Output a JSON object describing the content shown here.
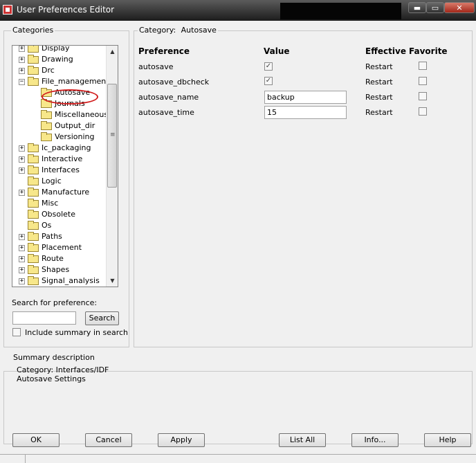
{
  "window": {
    "title": "User Preferences Editor",
    "minimize": "▬",
    "maximize": "▭",
    "close": "✕"
  },
  "categories": {
    "label": "Categories",
    "items": [
      {
        "label": "Display",
        "expander": "+"
      },
      {
        "label": "Drawing",
        "expander": "+"
      },
      {
        "label": "Drc",
        "expander": "+"
      },
      {
        "label": "File_management",
        "expander": "−"
      },
      {
        "label": "Autosave",
        "expander": ""
      },
      {
        "label": "Journals",
        "expander": ""
      },
      {
        "label": "Miscellaneous",
        "expander": ""
      },
      {
        "label": "Output_dir",
        "expander": ""
      },
      {
        "label": "Versioning",
        "expander": ""
      },
      {
        "label": "Ic_packaging",
        "expander": "+"
      },
      {
        "label": "Interactive",
        "expander": "+"
      },
      {
        "label": "Interfaces",
        "expander": "+"
      },
      {
        "label": "Logic",
        "expander": ""
      },
      {
        "label": "Manufacture",
        "expander": "+"
      },
      {
        "label": "Misc",
        "expander": ""
      },
      {
        "label": "Obsolete",
        "expander": ""
      },
      {
        "label": "Os",
        "expander": ""
      },
      {
        "label": "Paths",
        "expander": "+"
      },
      {
        "label": "Placement",
        "expander": "+"
      },
      {
        "label": "Route",
        "expander": "+"
      },
      {
        "label": "Shapes",
        "expander": "+"
      },
      {
        "label": "Signal_analysis",
        "expander": "+"
      }
    ],
    "scroll_up": "▲",
    "scroll_down": "▼",
    "grip": "≡"
  },
  "search": {
    "label": "Search for preference:",
    "value": "",
    "button": "Search",
    "include_summary": "Include summary in search",
    "include_checked": false
  },
  "category_panel": {
    "prefix": "Category:",
    "name": "Autosave"
  },
  "table": {
    "headers": {
      "preference": "Preference",
      "value": "Value",
      "effective": "Effective",
      "favorite": "Favorite"
    },
    "rows": [
      {
        "preference": "autosave",
        "value": "",
        "effective": "Restart",
        "checked": true,
        "favorite": false
      },
      {
        "preference": "autosave_dbcheck",
        "value": "",
        "effective": "Restart",
        "checked": true,
        "favorite": false
      },
      {
        "preference": "autosave_name",
        "value": "backup",
        "effective": "Restart",
        "favorite": false
      },
      {
        "preference": "autosave_time",
        "value": "15",
        "effective": "Restart",
        "favorite": false
      }
    ],
    "check_mark": "✓"
  },
  "summary": {
    "label": "Summary description",
    "line1": "Category: Interfaces/IDF",
    "line2": "Autosave Settings"
  },
  "buttons": {
    "ok": "OK",
    "cancel": "Cancel",
    "apply": "Apply",
    "list_all": "List All",
    "info": "Info...",
    "help": "Help"
  },
  "colors": {
    "highlight_circle": "#d11d1d",
    "folder": "#f7e78a"
  }
}
